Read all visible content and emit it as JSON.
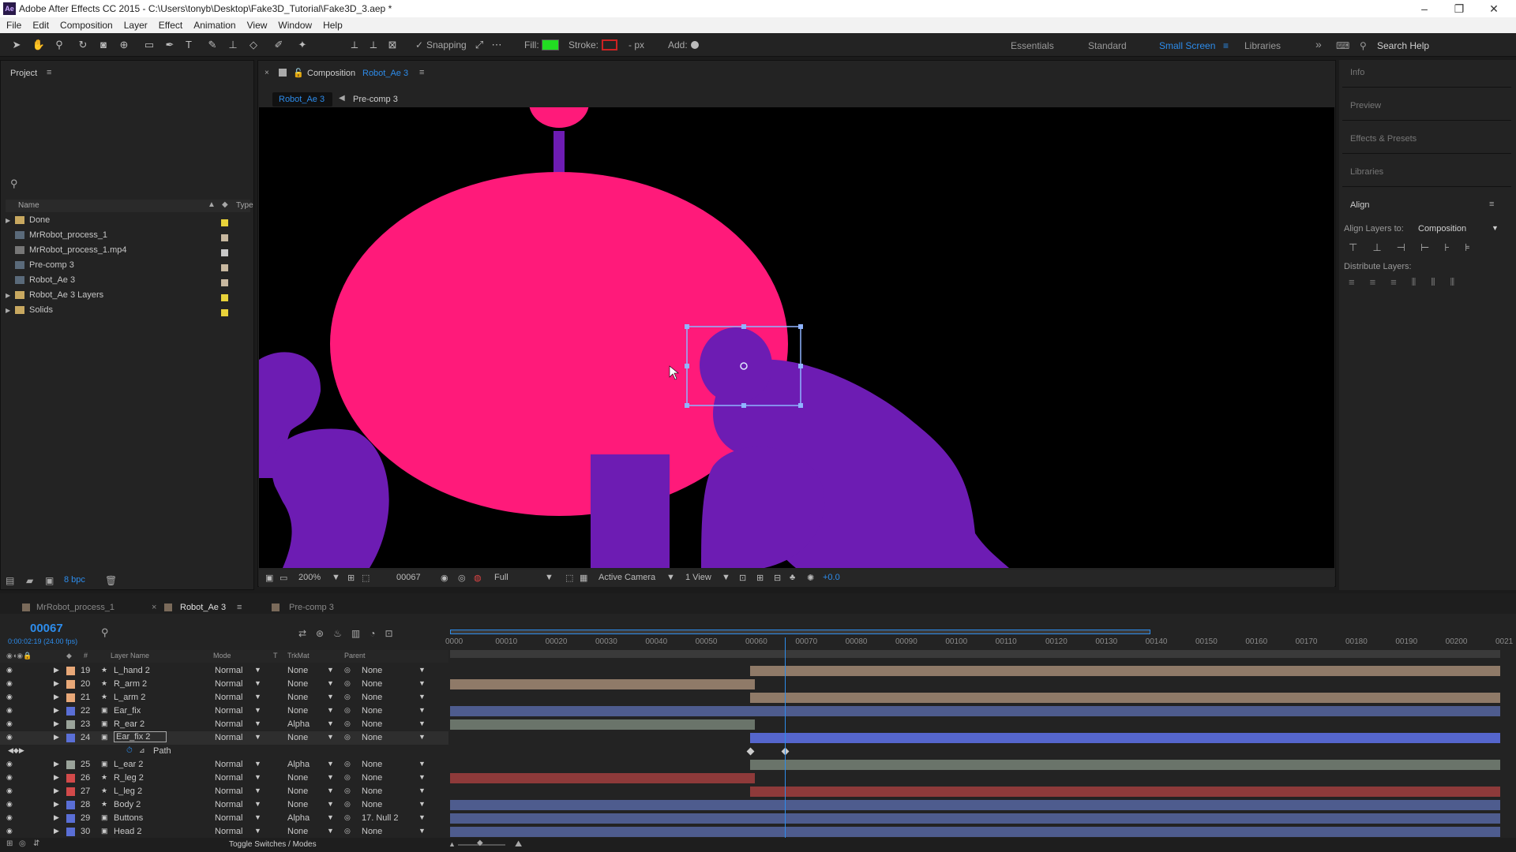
{
  "app": {
    "title": "Adobe After Effects CC 2015 - C:\\Users\\tonyb\\Desktop\\Fake3D_Tutorial\\Fake3D_3.aep *",
    "logo": "Ae"
  },
  "window_controls": {
    "minimize": "–",
    "restore": "❐",
    "close": "✕"
  },
  "menu": [
    "File",
    "Edit",
    "Composition",
    "Layer",
    "Effect",
    "Animation",
    "View",
    "Window",
    "Help"
  ],
  "toolbar": {
    "snapping_label": "Snapping",
    "snapping_check": "✓",
    "fill_label": "Fill:",
    "stroke_label": "Stroke:",
    "stroke_px": "- px",
    "add_label": "Add:",
    "workspaces": [
      "Essentials",
      "Standard",
      "Small Screen",
      "Libraries"
    ],
    "active_workspace": "Small Screen",
    "overflow": "»",
    "search_help": "Search Help",
    "fill_color": "#22dd22",
    "stroke_color": "#cc2222"
  },
  "project": {
    "title": "Project",
    "columns": {
      "name": "Name",
      "type": "Type"
    },
    "items": [
      {
        "label": "Done",
        "kind": "folder",
        "swatch": "#e8d23a"
      },
      {
        "label": "MrRobot_process_1",
        "kind": "comp",
        "swatch": "#c8b8a0"
      },
      {
        "label": "MrRobot_process_1.mp4",
        "kind": "footage",
        "swatch": "#c8c8c8"
      },
      {
        "label": "Pre-comp 3",
        "kind": "comp",
        "swatch": "#c8b8a0"
      },
      {
        "label": "Robot_Ae 3",
        "kind": "comp",
        "swatch": "#c8b8a0"
      },
      {
        "label": "Robot_Ae 3 Layers",
        "kind": "folder",
        "swatch": "#e8d23a"
      },
      {
        "label": "Solids",
        "kind": "folder",
        "swatch": "#e8d23a"
      }
    ],
    "bpc": "8 bpc"
  },
  "composition": {
    "panel_prefix": "Composition",
    "name": "Robot_Ae 3",
    "breadcrumbs": [
      "Robot_Ae 3",
      "Pre-comp 3"
    ],
    "zoom": "200%",
    "frame": "00067",
    "resolution": "Full",
    "camera": "Active Camera",
    "views": "1 View",
    "exposure": "+0.0"
  },
  "right_panels": [
    "Info",
    "Preview",
    "Effects & Presets",
    "Libraries"
  ],
  "align": {
    "title": "Align",
    "align_to_label": "Align Layers to:",
    "align_to_value": "Composition",
    "distribute_label": "Distribute Layers:"
  },
  "timeline": {
    "tabs": [
      "MrRobot_process_1",
      "Robot_Ae 3",
      "Pre-comp 3"
    ],
    "active_tab": "Robot_Ae 3",
    "timecode": "00067",
    "timecode_detail": "0:00:02:19 (24.00 fps)",
    "columns": {
      "hash": "#",
      "layer_name": "Layer Name",
      "mode": "Mode",
      "t": "T",
      "trkmat": "TrkMat",
      "parent": "Parent"
    },
    "ruler": [
      "0000",
      "00010",
      "00020",
      "00030",
      "00040",
      "00050",
      "00060",
      "00070",
      "00080",
      "00090",
      "00100",
      "00110",
      "00120",
      "00130",
      "00140",
      "00150",
      "00160",
      "00170",
      "00180",
      "00190",
      "00200",
      "0021"
    ],
    "playhead": 67,
    "work_area": [
      0,
      140
    ],
    "total_frames": 210,
    "layers": [
      {
        "num": "19",
        "name": "L_hand 2",
        "mode": "Normal",
        "trkmat": "None",
        "parent": "None",
        "color": "#e8a878",
        "bar_color": "#8f7a68",
        "bar_start": 60,
        "shape": true
      },
      {
        "num": "20",
        "name": "R_arm 2",
        "mode": "Normal",
        "trkmat": "None",
        "parent": "None",
        "color": "#e8a878",
        "bar_color": "#8f7a68",
        "bar_start": 0,
        "bar_end": 61,
        "shape": true
      },
      {
        "num": "21",
        "name": "L_arm 2",
        "mode": "Normal",
        "trkmat": "None",
        "parent": "None",
        "color": "#e8a878",
        "bar_color": "#8f7a68",
        "bar_start": 60,
        "shape": true
      },
      {
        "num": "22",
        "name": "Ear_fix",
        "mode": "Normal",
        "trkmat": "None",
        "parent": "None",
        "color": "#5a6fd6",
        "bar_color": "#4e5c8e",
        "bar_start": 0,
        "shape": false
      },
      {
        "num": "23",
        "name": "R_ear 2",
        "mode": "Normal",
        "trkmat": "Alpha",
        "parent": "None",
        "color": "#9aa39a",
        "bar_color": "#6a746a",
        "bar_start": 0,
        "bar_end": 61,
        "shape": false
      },
      {
        "num": "24",
        "name": "Ear_fix 2",
        "mode": "Normal",
        "trkmat": "None",
        "parent": "None",
        "color": "#5a6fd6",
        "bar_color": "#5566cc",
        "bar_start": 60,
        "shape": false,
        "selected": true
      },
      {
        "num": "25",
        "name": "L_ear 2",
        "mode": "Normal",
        "trkmat": "Alpha",
        "parent": "None",
        "color": "#9aa39a",
        "bar_color": "#6a746a",
        "bar_start": 60,
        "shape": false
      },
      {
        "num": "26",
        "name": "R_leg 2",
        "mode": "Normal",
        "trkmat": "None",
        "parent": "None",
        "color": "#d24a4a",
        "bar_color": "#8e3a3a",
        "bar_start": 0,
        "bar_end": 61,
        "shape": true
      },
      {
        "num": "27",
        "name": "L_leg 2",
        "mode": "Normal",
        "trkmat": "None",
        "parent": "None",
        "color": "#d24a4a",
        "bar_color": "#8e3a3a",
        "bar_start": 60,
        "shape": true
      },
      {
        "num": "28",
        "name": "Body 2",
        "mode": "Normal",
        "trkmat": "None",
        "parent": "None",
        "color": "#5a6fd6",
        "bar_color": "#4e5c8e",
        "bar_start": 0,
        "shape": true
      },
      {
        "num": "29",
        "name": "Buttons",
        "mode": "Normal",
        "trkmat": "Alpha",
        "parent": "17. Null 2",
        "color": "#5a6fd6",
        "bar_color": "#4e5c8e",
        "bar_start": 0,
        "shape": false
      },
      {
        "num": "30",
        "name": "Head 2",
        "mode": "Normal",
        "trkmat": "None",
        "parent": "None",
        "color": "#5a6fd6",
        "bar_color": "#4e5c8e",
        "bar_start": 0,
        "shape": false
      }
    ],
    "path_label": "Path",
    "toggle_label": "Toggle Switches / Modes"
  }
}
